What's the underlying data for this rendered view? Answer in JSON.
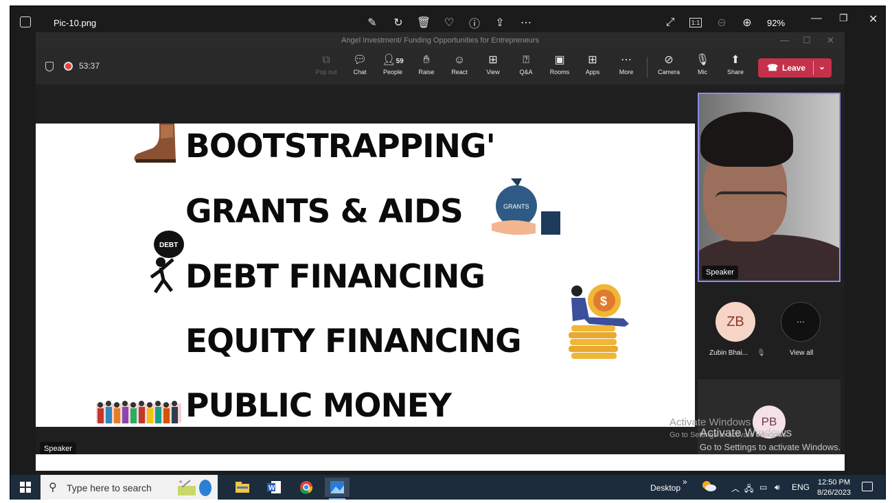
{
  "viewer": {
    "file_name": "Pic-10.png",
    "zoom": "92%",
    "zoom_ratio_label": "1:1"
  },
  "teams": {
    "window_title": "Angel Investment/ Funding Opportunities for Entrepreneurs",
    "timer": "53:37",
    "people_count": "59",
    "toolbar": [
      {
        "label": "Pop out",
        "icon": "pop-out-icon",
        "disabled": true
      },
      {
        "label": "Chat",
        "icon": "chat-icon"
      },
      {
        "label": "People",
        "icon": "people-icon"
      },
      {
        "label": "Raise",
        "icon": "hand-icon"
      },
      {
        "label": "React",
        "icon": "smiley-icon"
      },
      {
        "label": "View",
        "icon": "grid-icon"
      },
      {
        "label": "Q&A",
        "icon": "qa-icon"
      },
      {
        "label": "Rooms",
        "icon": "rooms-icon"
      },
      {
        "label": "Apps",
        "icon": "plus-box-icon"
      },
      {
        "label": "More",
        "icon": "ellipsis-icon"
      },
      {
        "label": "Camera",
        "icon": "camera-off-icon"
      },
      {
        "label": "Mic",
        "icon": "mic-off-icon"
      },
      {
        "label": "Share",
        "icon": "share-icon"
      }
    ],
    "leave_label": "Leave",
    "leave_color": "#c4314b"
  },
  "slide": {
    "lines": [
      "BOOTSTRAPPING'",
      "GRANTS & AIDS",
      "DEBT FINANCING",
      "EQUITY FINANCING",
      "PUBLIC MONEY"
    ],
    "grants_bag_label": "GRANTS",
    "debt_bag_label": "DEBT"
  },
  "speaker_label": "Speaker",
  "participants": {
    "zb_initials": "ZB",
    "zb_name": "Zubin Bhai...",
    "view_all_label": "View all",
    "pb_initials": "PB"
  },
  "watermark": {
    "line1": "Activate Windows",
    "line2": "Go to Settings to activate Windows."
  },
  "taskbar": {
    "search_placeholder": "Type here to search",
    "desktop_label": "Desktop",
    "language": "ENG",
    "time": "12:50 PM",
    "date": "8/26/2023"
  }
}
